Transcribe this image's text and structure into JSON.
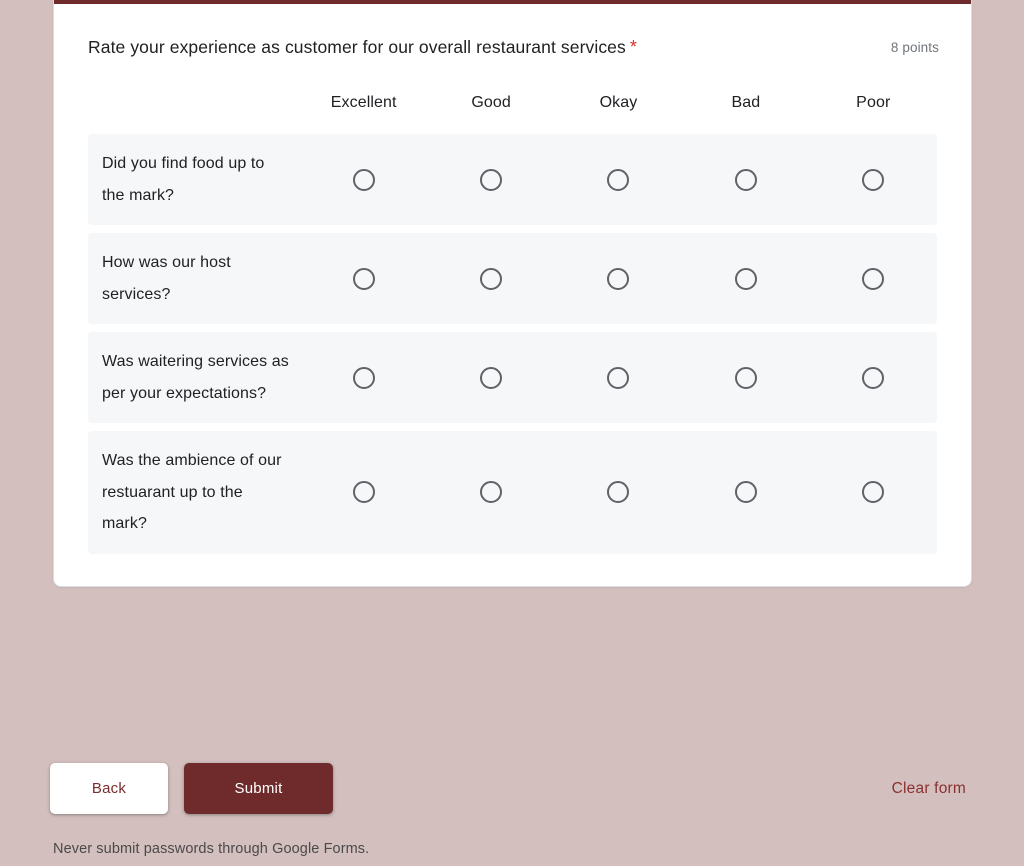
{
  "theme": {
    "page_background": "#d3bfbd",
    "accent": "#6f2b2b",
    "card_background": "#ffffff",
    "row_background": "#f6f7f9",
    "required_marker_color": "#d93025",
    "link_color": "#8b3131"
  },
  "question": {
    "title": "Rate your experience as customer for our overall restaurant services",
    "required_marker": "*",
    "points": "8 points"
  },
  "grid": {
    "row_header_blank": "",
    "columns": [
      {
        "label": "Excellent"
      },
      {
        "label": "Good"
      },
      {
        "label": "Okay"
      },
      {
        "label": "Bad"
      },
      {
        "label": "Poor"
      }
    ],
    "rows": [
      {
        "label": "Did you find food up to the mark?",
        "selected": null
      },
      {
        "label": "How was our host services?",
        "selected": null
      },
      {
        "label": "Was waitering services as per your expectations?",
        "selected": null
      },
      {
        "label": "Was the ambience of our restuarant up to the mark?",
        "selected": null
      }
    ]
  },
  "actions": {
    "back_label": "Back",
    "submit_label": "Submit",
    "clear_form_label": "Clear form"
  },
  "footer": {
    "disclaimer": "Never submit passwords through Google Forms."
  }
}
